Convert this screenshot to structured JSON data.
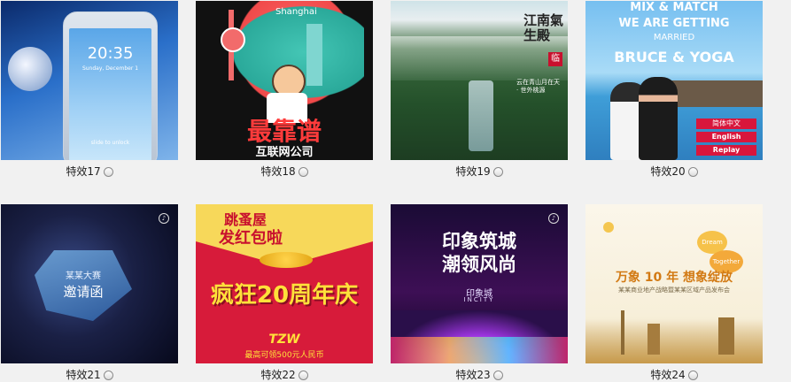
{
  "items": [
    {
      "caption": "特效17",
      "thumb_text": {
        "clock": "20:35",
        "date": "Sunday, December 1",
        "unlock": "slide to unlock"
      }
    },
    {
      "caption": "特效18",
      "thumb_text": {
        "city": "Shanghai",
        "headline": "最靠谱",
        "subline": "互联网公司"
      }
    },
    {
      "caption": "特效19",
      "thumb_text": {
        "title": "江南氣生殿",
        "seal": "临",
        "poem": "云在青山月在天 · 世外桃源"
      }
    },
    {
      "caption": "特效20",
      "thumb_text": {
        "line1": "MIX & MATCH",
        "line2": "WE ARE GETTING",
        "line3": "MARRIED",
        "line4": "BRUCE & YOGA",
        "btn1": "简体中文",
        "btn2": "English",
        "btn3": "Replay"
      }
    },
    {
      "caption": "特效21",
      "thumb_text": {
        "line1": "某某大赛",
        "line2": "邀请函"
      }
    },
    {
      "caption": "特效22",
      "thumb_text": {
        "line1": "跳蚤屋",
        "line2": "发红包啦",
        "big": "疯狂20周年庆",
        "logo": "TZW",
        "footer": "最高可领500元人民币"
      }
    },
    {
      "caption": "特效23",
      "thumb_text": {
        "line1": "印象筑城",
        "line2": "潮领风尚",
        "brand": "印象城",
        "brand_en": "INCITY"
      }
    },
    {
      "caption": "特效24",
      "thumb_text": {
        "headline": "万象 10 年  想象绽放",
        "sub": "某某商业地产战略暨某某区域产品发布会",
        "bubble1": "Dream",
        "bubble2": "Together"
      }
    }
  ],
  "colors": {
    "background": "#f1f1f1",
    "caption_text": "#222222"
  }
}
